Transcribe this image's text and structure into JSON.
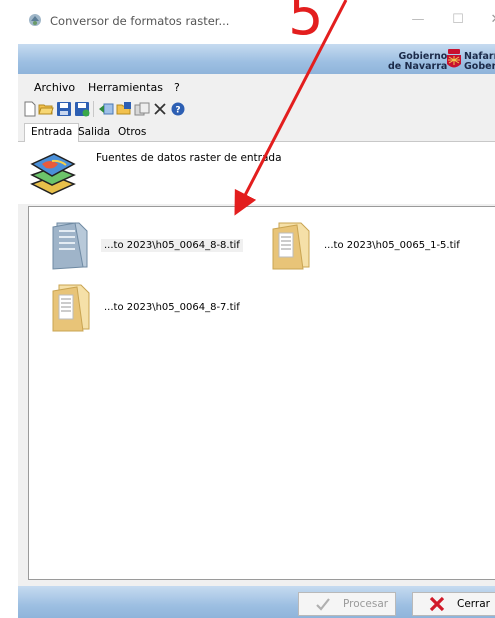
{
  "window": {
    "title": "Conversor de formatos raster...",
    "controls": {
      "minimize": "—",
      "maximize": "☐",
      "close": "✕"
    }
  },
  "banner": {
    "brand_left_line1": "Gobierno",
    "brand_left_line2": "de Navarra",
    "brand_right_line1": "Nafarro",
    "brand_right_line2": "Gobern",
    "colors": {
      "band_top": "#c6dbf0",
      "band_bottom": "#8fb4da",
      "crest_red": "#c8102e"
    }
  },
  "menu": {
    "items": [
      "Archivo",
      "Herramientas",
      "?"
    ]
  },
  "toolbar": {
    "icons": [
      "new-icon",
      "open-folder-icon",
      "save-icon",
      "save-as-icon",
      "import-icon",
      "add-folder-icon",
      "export-icon",
      "delete-icon",
      "help-icon"
    ]
  },
  "tabs": {
    "items": [
      "Entrada",
      "Salida",
      "Otros"
    ],
    "active": "Entrada"
  },
  "header": {
    "text": "Fuentes de datos raster de entrada"
  },
  "files": [
    {
      "label": "...to 2023\\h05_0064_8-8.tif",
      "selected": true
    },
    {
      "label": "...to 2023\\h05_0065_1-5.tif",
      "selected": false
    },
    {
      "label": "...to 2023\\h05_0064_8-7.tif",
      "selected": false
    }
  ],
  "buttons": {
    "process": "Procesar",
    "close": "Cerrar"
  },
  "annotation": {
    "number": "5",
    "color": "#e31e1e"
  }
}
